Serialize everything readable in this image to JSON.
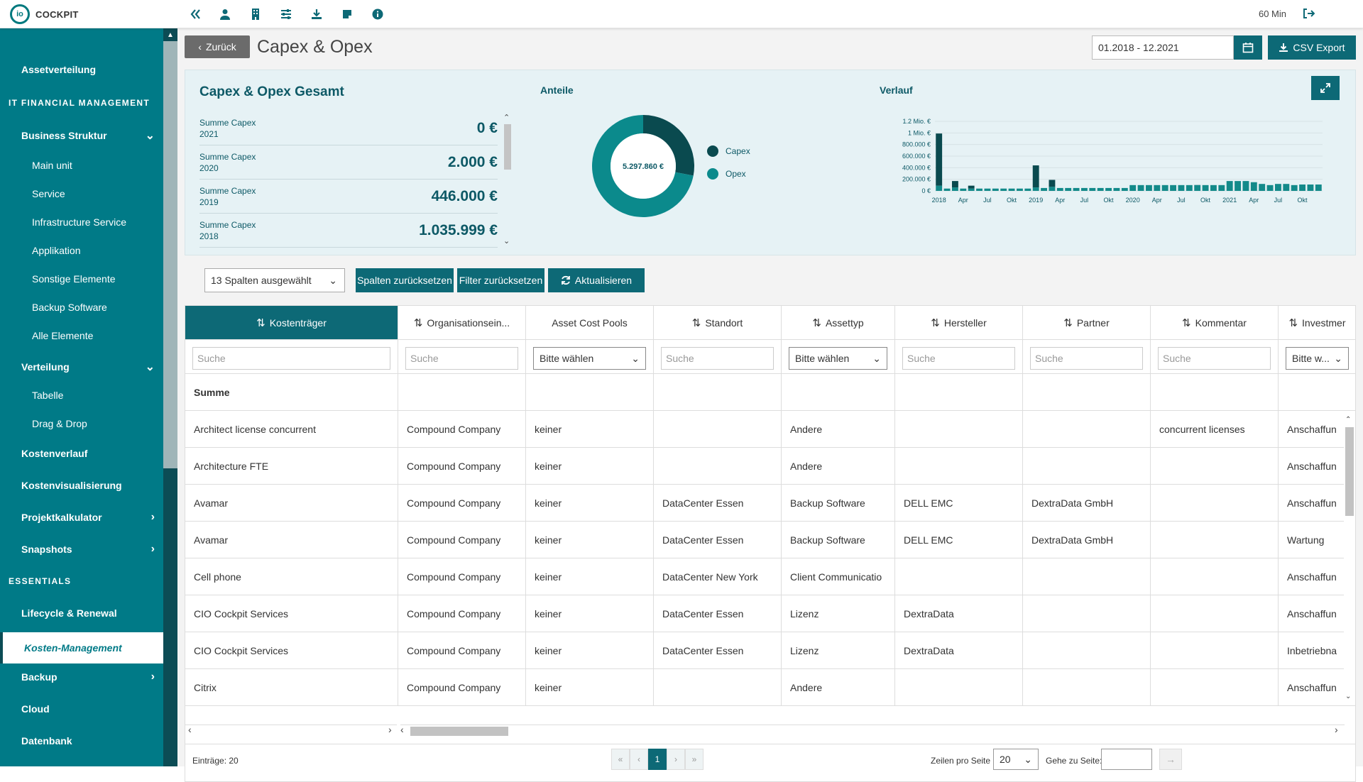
{
  "app": {
    "logo_text": "COCKPIT",
    "session": "60 Min"
  },
  "top_icons": [
    "double-chevron-left-icon",
    "user-icon",
    "building-icon",
    "sliders-icon",
    "download-icon",
    "sticky-note-icon",
    "info-icon"
  ],
  "sidebar": {
    "items": [
      {
        "label": "Assetverteilung",
        "type": "l1"
      },
      {
        "label": "IT FINANCIAL MANAGEMENT",
        "type": "sec"
      },
      {
        "label": "Business Struktur",
        "type": "l1",
        "chev": "down"
      },
      {
        "label": "Main unit",
        "type": "l2"
      },
      {
        "label": "Service",
        "type": "l2"
      },
      {
        "label": "Infrastructure Service",
        "type": "l2"
      },
      {
        "label": "Applikation",
        "type": "l2"
      },
      {
        "label": "Sonstige Elemente",
        "type": "l2"
      },
      {
        "label": "Backup Software",
        "type": "l2"
      },
      {
        "label": "Alle Elemente",
        "type": "l2"
      },
      {
        "label": "Verteilung",
        "type": "l1",
        "chev": "down"
      },
      {
        "label": "Tabelle",
        "type": "l2"
      },
      {
        "label": "Drag & Drop",
        "type": "l2"
      },
      {
        "label": "Kostenverlauf",
        "type": "l1"
      },
      {
        "label": "Kostenvisualisierung",
        "type": "l1"
      },
      {
        "label": "Projektkalkulator",
        "type": "l1",
        "chev": "right"
      },
      {
        "label": "Snapshots",
        "type": "l1",
        "chev": "right"
      },
      {
        "label": "ESSENTIALS",
        "type": "sec"
      },
      {
        "label": "Lifecycle & Renewal",
        "type": "l1"
      },
      {
        "label": "Kosten-Management",
        "type": "active"
      },
      {
        "label": "Backup",
        "type": "l1",
        "chev": "right"
      },
      {
        "label": "Cloud",
        "type": "l1"
      },
      {
        "label": "Datenbank",
        "type": "l1"
      }
    ]
  },
  "header": {
    "back_label": "Zurück",
    "title": "Capex & Opex",
    "date_range": "01.2018 - 12.2021",
    "csv_label": "CSV Export"
  },
  "summary": {
    "title": "Capex & Opex Gesamt",
    "rows": [
      {
        "label": "Summe Capex",
        "year": "2021",
        "value": "0 €"
      },
      {
        "label": "Summe Capex",
        "year": "2020",
        "value": "2.000 €"
      },
      {
        "label": "Summe Capex",
        "year": "2019",
        "value": "446.000 €"
      },
      {
        "label": "Summe Capex",
        "year": "2018",
        "value": "1.035.999 €"
      }
    ],
    "anteile_title": "Anteile",
    "total": "5.297.860 €",
    "legend": [
      {
        "name": "Capex",
        "color": "#0a4a4f"
      },
      {
        "name": "Opex",
        "color": "#0b8a8c"
      }
    ],
    "verlauf_title": "Verlauf"
  },
  "chart_data": [
    {
      "type": "pie",
      "title": "Anteile",
      "center_label": "5.297.860 €",
      "categories": [
        "Capex",
        "Opex"
      ],
      "values": [
        1483999,
        3813861
      ]
    },
    {
      "type": "bar",
      "title": "Verlauf",
      "y_tick_labels": [
        "0 €",
        "200.000 €",
        "400.000 €",
        "600.000 €",
        "800.000 €",
        "1 Mio. €",
        "1.2 Mio. €"
      ],
      "ylim": [
        0,
        1200000
      ],
      "x_tick_labels": [
        "2018",
        "Apr",
        "Jul",
        "Okt",
        "2019",
        "Apr",
        "Jul",
        "Okt",
        "2020",
        "Apr",
        "Jul",
        "Okt",
        "2021",
        "Apr",
        "Jul",
        "Okt"
      ],
      "series": [
        {
          "name": "Capex",
          "color": "#0a4a4f",
          "values": [
            900000,
            0,
            110000,
            0,
            50000,
            0,
            0,
            0,
            0,
            0,
            0,
            0,
            380000,
            0,
            120000,
            0,
            0,
            0,
            0,
            0,
            0,
            0,
            0,
            0,
            0,
            0,
            0,
            0,
            0,
            0,
            0,
            0,
            2000,
            0,
            0,
            0,
            0,
            0,
            0,
            0,
            0,
            0,
            0,
            0,
            0,
            0,
            0,
            0
          ]
        },
        {
          "name": "Opex",
          "color": "#138a8a",
          "values": [
            90000,
            40000,
            60000,
            40000,
            40000,
            40000,
            40000,
            40000,
            40000,
            40000,
            40000,
            40000,
            60000,
            50000,
            70000,
            50000,
            50000,
            50000,
            50000,
            50000,
            50000,
            50000,
            50000,
            50000,
            100000,
            100000,
            100000,
            100000,
            100000,
            100000,
            100000,
            100000,
            100000,
            100000,
            100000,
            100000,
            170000,
            170000,
            170000,
            150000,
            120000,
            100000,
            120000,
            120000,
            100000,
            110000,
            110000,
            110000
          ]
        }
      ]
    }
  ],
  "toolbar": {
    "col_select": "13 Spalten ausgewählt",
    "reset_cols": "Spalten zurücksetzen",
    "reset_filters": "Filter zurücksetzen",
    "refresh": "Aktualisieren"
  },
  "grid": {
    "columns": [
      {
        "label": "Kostenträger",
        "sort": true,
        "filter": "input"
      },
      {
        "label": "Organisationsein...",
        "sort": true,
        "filter": "input"
      },
      {
        "label": "Asset Cost Pools",
        "sort": false,
        "filter": "select"
      },
      {
        "label": "Standort",
        "sort": true,
        "filter": "input"
      },
      {
        "label": "Assettyp",
        "sort": true,
        "filter": "select"
      },
      {
        "label": "Hersteller",
        "sort": true,
        "filter": "input"
      },
      {
        "label": "Partner",
        "sort": true,
        "filter": "input"
      },
      {
        "label": "Kommentar",
        "sort": true,
        "filter": "input"
      },
      {
        "label": "Investmer",
        "sort": true,
        "filter": "select"
      }
    ],
    "filter_placeholder": "Suche",
    "select_placeholder": "Bitte wählen",
    "select_placeholder_short": "Bitte w...",
    "sum_label": "Summe",
    "rows": [
      [
        "Architect license concurrent",
        "Compound Company",
        "keiner",
        "",
        "Andere",
        "",
        "",
        "concurrent licenses",
        "Anschaffun"
      ],
      [
        "Architecture FTE",
        "Compound Company",
        "keiner",
        "",
        "Andere",
        "",
        "",
        "",
        "Anschaffun"
      ],
      [
        "Avamar",
        "Compound Company",
        "keiner",
        "DataCenter Essen",
        "Backup Software",
        "DELL EMC",
        "DextraData GmbH",
        "",
        "Anschaffun"
      ],
      [
        "Avamar",
        "Compound Company",
        "keiner",
        "DataCenter Essen",
        "Backup Software",
        "DELL EMC",
        "DextraData GmbH",
        "",
        "Wartung"
      ],
      [
        "Cell phone",
        "Compound Company",
        "keiner",
        "DataCenter New York",
        "Client Communicatio",
        "",
        "",
        "",
        "Anschaffun"
      ],
      [
        "CIO Cockpit Services",
        "Compound Company",
        "keiner",
        "DataCenter Essen",
        "Lizenz",
        "DextraData",
        "",
        "",
        "Anschaffun"
      ],
      [
        "CIO Cockpit Services",
        "Compound Company",
        "keiner",
        "DataCenter Essen",
        "Lizenz",
        "DextraData",
        "",
        "",
        "Inbetriebna"
      ],
      [
        "Citrix",
        "Compound Company",
        "keiner",
        "",
        "Andere",
        "",
        "",
        "",
        "Anschaffun"
      ]
    ]
  },
  "footer": {
    "entries": "Einträge: 20",
    "pages": [
      "«",
      "‹",
      "1",
      "›",
      "»"
    ],
    "rows_per_page_label": "Zeilen pro Seite",
    "rows_per_page": "20",
    "goto_label": "Gehe zu Seite:"
  }
}
